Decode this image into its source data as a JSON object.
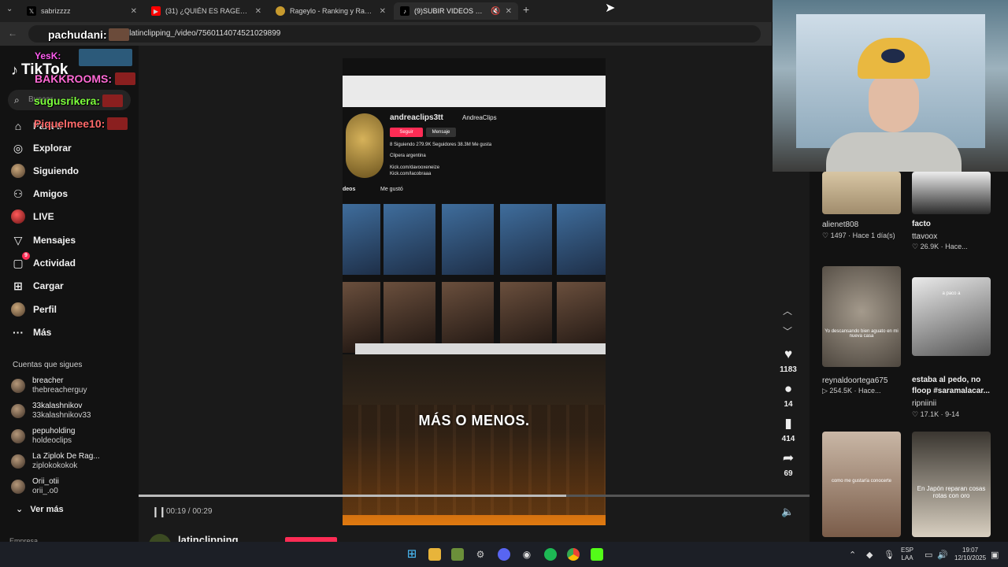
{
  "browser": {
    "tabs": [
      {
        "title": "sabrizzzz",
        "favicon": "x-twitter-icon",
        "active": false
      },
      {
        "title": "(31) ¿QUIÉN ES RAGEYLO? Lolo",
        "favicon": "youtube-icon",
        "active": false
      },
      {
        "title": "Rageylo - Ranking y Racha de",
        "favicon": "rank-site-icon",
        "active": false
      },
      {
        "title": "(9)SUBIR VIDEOS CON EL LI",
        "favicon": "tiktok-icon",
        "active": true
      }
    ],
    "new_tab": "+",
    "url": "@latinclipping_/video/7560114074521029899"
  },
  "chat_overlay": [
    {
      "name": "pachudani:",
      "color": "#ffffff"
    },
    {
      "name": "YesK:",
      "color": "#ff5cf0"
    },
    {
      "name": "BAKKROOMS:",
      "color": "#ff6ad5"
    },
    {
      "name": "sugusrikera:",
      "color": "#7dff3c"
    },
    {
      "name": "Piquelmee10:",
      "color": "#ff6a6a"
    }
  ],
  "sidebar": {
    "logo": "TikTok",
    "search_placeholder": "Buscar",
    "nav": [
      {
        "label": "Para ti",
        "icon": "home-icon"
      },
      {
        "label": "Explorar",
        "icon": "compass-icon"
      },
      {
        "label": "Siguiendo",
        "icon": "avatar-icon"
      },
      {
        "label": "Amigos",
        "icon": "friends-icon"
      },
      {
        "label": "LIVE",
        "icon": "live-icon"
      },
      {
        "label": "Mensajes",
        "icon": "messages-icon"
      },
      {
        "label": "Actividad",
        "icon": "activity-icon",
        "badge": "9"
      },
      {
        "label": "Cargar",
        "icon": "upload-icon"
      },
      {
        "label": "Perfil",
        "icon": "profile-icon"
      },
      {
        "label": "Más",
        "icon": "more-icon"
      }
    ],
    "following_title": "Cuentas que sigues",
    "following": [
      {
        "name": "breacher",
        "handle": "thebreacherguy"
      },
      {
        "name": "33kalashnikov",
        "handle": "33kalashnikov33"
      },
      {
        "name": "pepuholding",
        "handle": "holdeoclips"
      },
      {
        "name": "La Ziplok De Rag...",
        "handle": "ziplokokokok"
      },
      {
        "name": "Orii_otii",
        "handle": "orii_.o0"
      }
    ],
    "see_more": "Ver más",
    "footer": "Empresa"
  },
  "video": {
    "subtitle": "MÁS O MENOS.",
    "screen": {
      "username": "andreaclips3tt",
      "display_name": "AndreaClips",
      "follow_btn": "Seguir",
      "message_btn": "Mensaje",
      "stats": "8 Siguiendo   279.9K Seguidores   38.3M Me gusta",
      "bio1": "Clipera argentina",
      "bio2": "Kick.com/davooxeneize",
      "bio3": "Kick.com/lacobraaa",
      "tab_videos": "deos",
      "tab_likes": "Me gustó"
    },
    "time": "00:19 / 00:29",
    "progress": 0.637,
    "author": "latinclipping",
    "follow_label": "Seguir"
  },
  "actions": {
    "likes": "1183",
    "comments": "14",
    "saves": "414",
    "shares": "69"
  },
  "grid": [
    {
      "title": "alienet808",
      "stat": "♡ 1497 · Hace 1 día(s)",
      "user": ""
    },
    {
      "title": "facto",
      "stat": "♡ 26.9K · Hace...",
      "user": "ttavoox"
    },
    {
      "title": "reynaldoortega675",
      "stat": "▷ 254.5K · Hace...",
      "user": "",
      "caption": "Yo descansando bien aguato en mi nueva casa"
    },
    {
      "title": "estaba al pedo, no floop #saramalacar...",
      "stat": "♡ 17.1K · 9-14",
      "user": "ripniinii",
      "caption": "a paco a"
    },
    {
      "caption": "como me gustaría conocerte"
    },
    {
      "caption": "En Japón reparan cosas rotas con oro"
    }
  ],
  "taskbar": {
    "lang": "ESP",
    "lang2": "LAA",
    "time": "19:07",
    "date": "12/10/2025"
  },
  "colors": {
    "accent": "#fe2c55",
    "background": "#121212"
  }
}
